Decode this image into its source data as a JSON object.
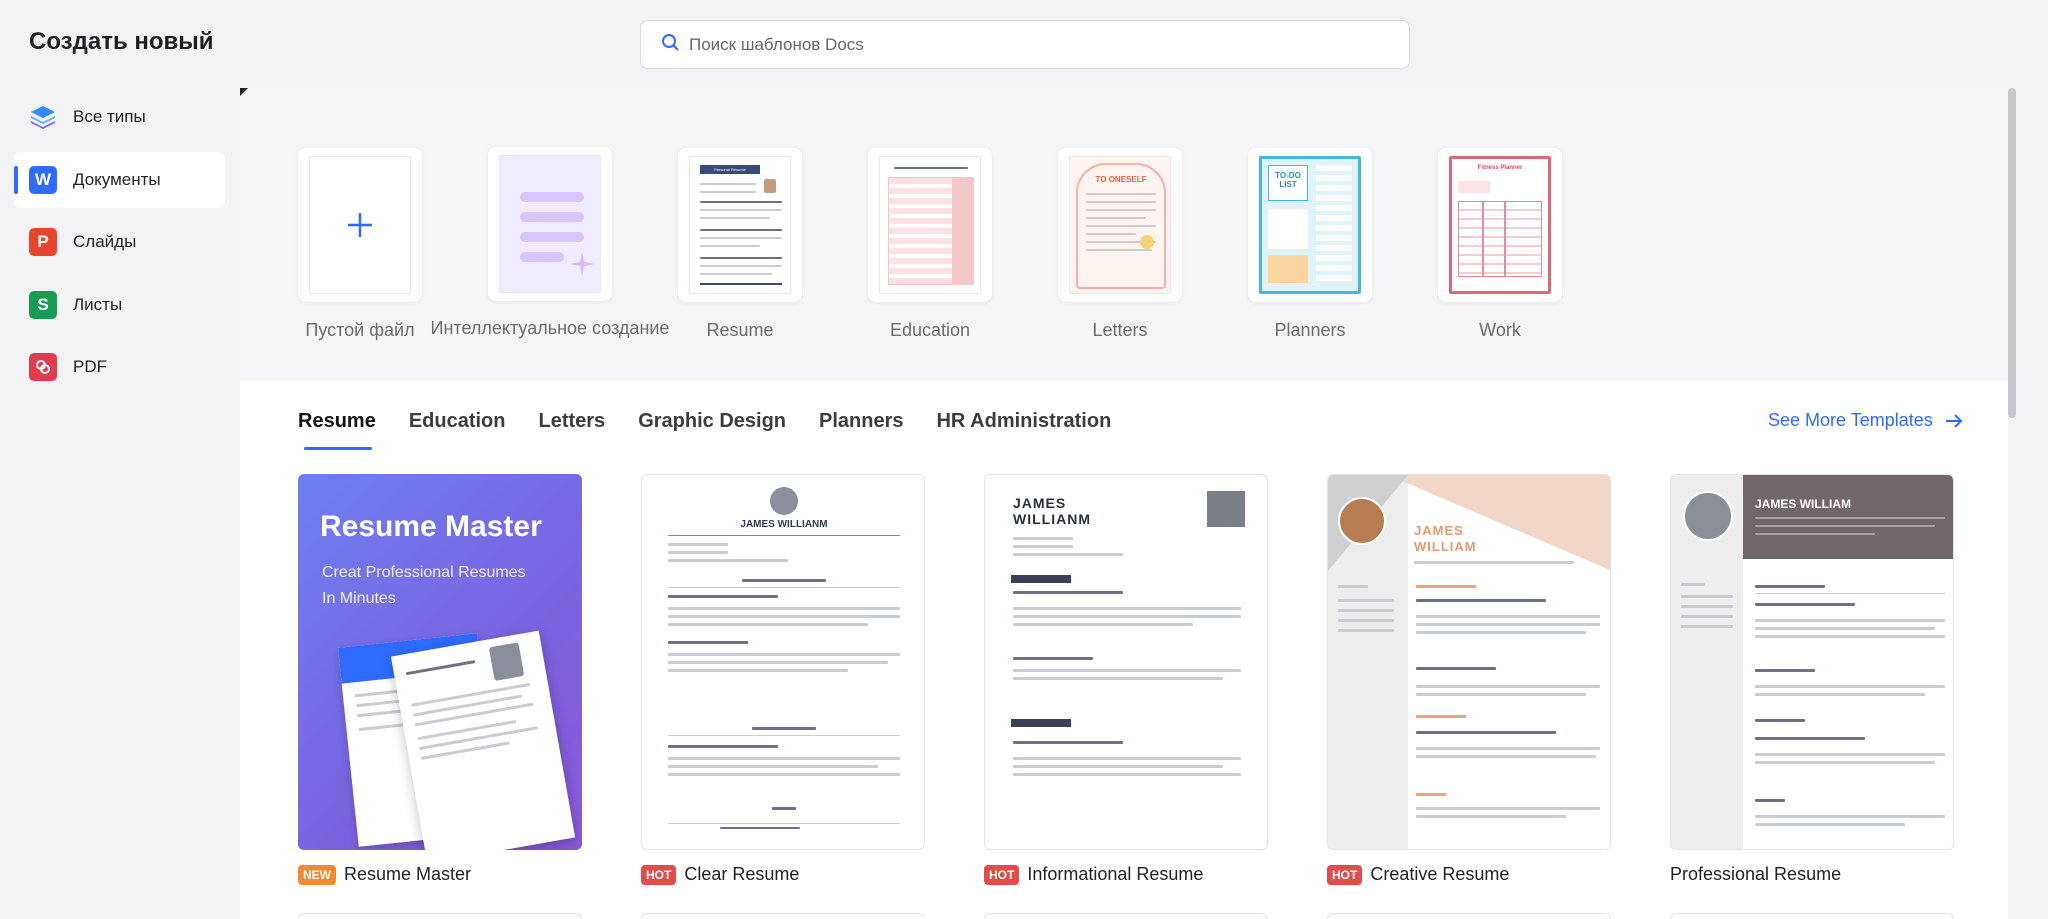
{
  "sidebar": {
    "title": "Создать новый",
    "items": [
      {
        "label": "Все типы",
        "icon": "layers-icon"
      },
      {
        "label": "Документы",
        "icon": "word-doc-icon",
        "letter": "W",
        "color": "#2f6bff"
      },
      {
        "label": "Слайды",
        "icon": "slides-icon",
        "letter": "P",
        "color": "#e8452e"
      },
      {
        "label": "Листы",
        "icon": "sheets-icon",
        "letter": "S",
        "color": "#1a9b54"
      },
      {
        "label": "PDF",
        "icon": "pdf-icon",
        "letter": "P",
        "color": "#e23b4d"
      }
    ]
  },
  "search": {
    "placeholder": "Поиск шаблонов Docs"
  },
  "quick_templates": [
    {
      "label": "Пустой файл"
    },
    {
      "label": "Интеллектуальное создание"
    },
    {
      "label": "Resume"
    },
    {
      "label": "Education"
    },
    {
      "label": "Letters"
    },
    {
      "label": "Planners"
    },
    {
      "label": "Work"
    }
  ],
  "thumb_text": {
    "resume": "Personal Resume",
    "letters": "TO ONESELF",
    "planners_a": "TO-DO",
    "planners_b": "LIST",
    "work": "Fitness Planner"
  },
  "tabs": [
    {
      "label": "Resume"
    },
    {
      "label": "Education"
    },
    {
      "label": "Letters"
    },
    {
      "label": "Graphic Design"
    },
    {
      "label": "Planners"
    },
    {
      "label": "HR Administration"
    }
  ],
  "see_more": "See More Templates",
  "cards": [
    {
      "badge": "NEW",
      "title": "Resume Master",
      "headline": "Resume Master",
      "sub1": "Creat Professional Resumes",
      "sub2": "In Minutes"
    },
    {
      "badge": "HOT",
      "title": "Clear Resume",
      "name": "JAMES WILLIANM"
    },
    {
      "badge": "HOT",
      "title": "Informational Resume",
      "name1": "JAMES",
      "name2": "WILLIANM"
    },
    {
      "badge": "HOT",
      "title": "Creative Resume",
      "name1": "JAMES",
      "name2": "WILLIAM"
    },
    {
      "badge": "",
      "title": "Professional Resume",
      "name": "JAMES WILLIAM"
    }
  ],
  "colors": {
    "accent": "#2f6bff",
    "new_badge": "#f08a34",
    "hot_badge": "#e24c4c"
  }
}
